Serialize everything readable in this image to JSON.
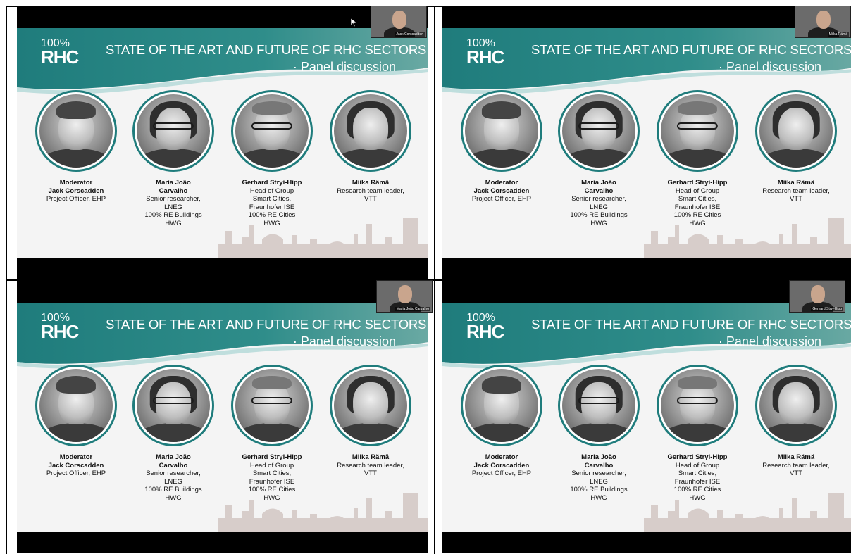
{
  "slide": {
    "logo_pct": "100%",
    "logo_text": "RHC",
    "title_line1": "STATE OF THE ART AND FUTURE OF RHC SECTORS",
    "title_line2": "· Panel discussion"
  },
  "people": [
    {
      "lines_bold": [
        "Moderator",
        "Jack Corscadden"
      ],
      "lines": [
        "Project Officer, EHP"
      ]
    },
    {
      "lines_bold": [
        "Maria João",
        "Carvalho"
      ],
      "lines": [
        "Senior researcher,",
        "LNEG",
        "100% RE Buildings",
        "HWG"
      ]
    },
    {
      "lines_bold": [
        "Gerhard Stryi-Hipp"
      ],
      "lines": [
        "Head of Group",
        "Smart Cities,",
        "Fraunhofer ISE",
        "100% RE Cities",
        "HWG"
      ]
    },
    {
      "lines_bold": [
        "Miika Rämä"
      ],
      "lines": [
        "Research team leader,",
        "VTT"
      ]
    }
  ],
  "thumbnails": [
    {
      "name": "Jack Corscadden"
    },
    {
      "name": "Miika Rämä"
    },
    {
      "name": "Maria João Carvalho"
    },
    {
      "name": "Gerhard Stryi-Hipp"
    }
  ],
  "colors": {
    "teal": "#1f7c7c",
    "teal_light": "#5aa7a4",
    "skyline": "#d7cdca"
  }
}
